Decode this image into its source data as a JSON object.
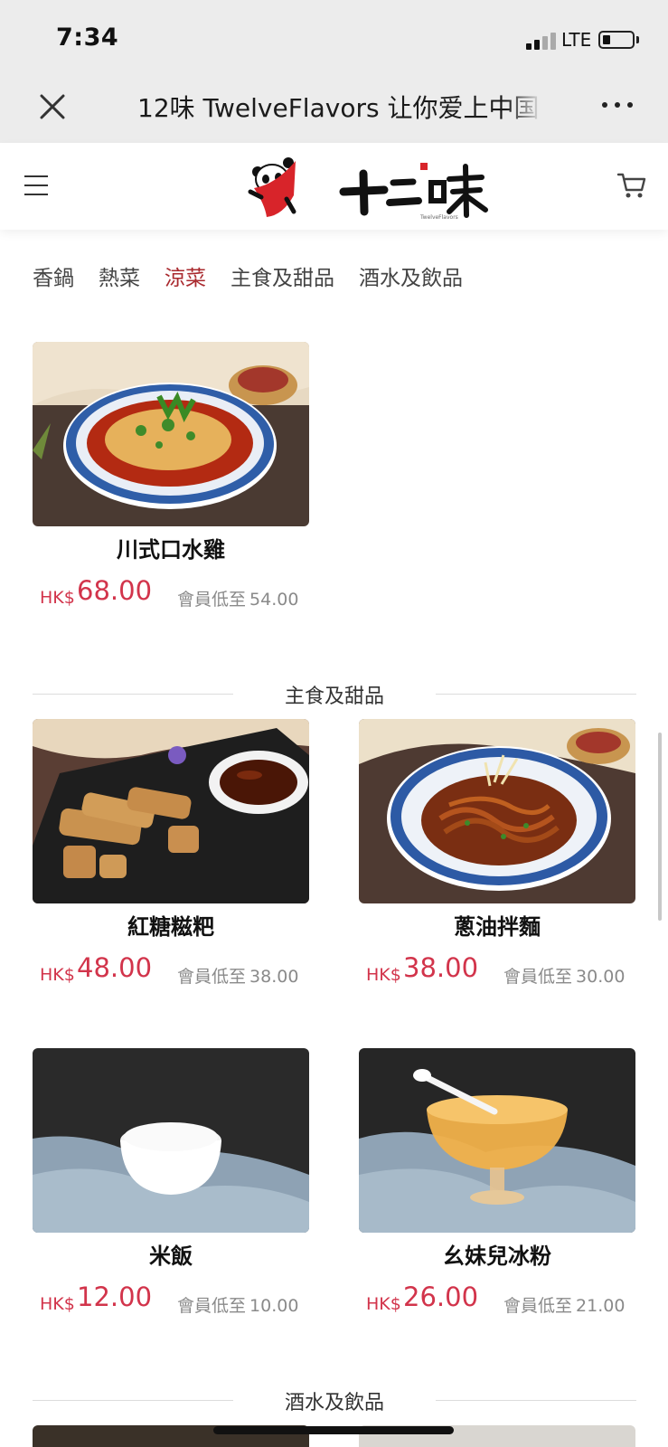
{
  "status_bar": {
    "time": "7:34",
    "network": "LTE"
  },
  "browser": {
    "title": "12味 TwelveFlavors 让你爱上中国",
    "close_icon": "close-icon",
    "more_icon": "more-dots-icon"
  },
  "header": {
    "menu_icon": "hamburger-menu-icon",
    "logo_text": "十二味",
    "cart_icon": "cart-icon"
  },
  "tabs": [
    {
      "label": "香鍋",
      "active": false
    },
    {
      "label": "熱菜",
      "active": false
    },
    {
      "label": "涼菜",
      "active": true
    },
    {
      "label": "主食及甜品",
      "active": false
    },
    {
      "label": "酒水及飲品",
      "active": false
    }
  ],
  "sections": {
    "staples": "主食及甜品",
    "drinks": "酒水及飲品"
  },
  "products": [
    {
      "name": "川式口水雞",
      "currency": "HK$",
      "price": "68.00",
      "member_label": "會員低至",
      "member_price": "54.00"
    },
    {
      "name": "紅糖糍粑",
      "currency": "HK$",
      "price": "48.00",
      "member_label": "會員低至",
      "member_price": "38.00"
    },
    {
      "name": "蔥油拌麵",
      "currency": "HK$",
      "price": "38.00",
      "member_label": "會員低至",
      "member_price": "30.00"
    },
    {
      "name": "米飯",
      "currency": "HK$",
      "price": "12.00",
      "member_label": "會員低至",
      "member_price": "10.00"
    },
    {
      "name": "幺妹兒冰粉",
      "currency": "HK$",
      "price": "26.00",
      "member_label": "會員低至",
      "member_price": "21.00"
    }
  ],
  "colors": {
    "accent": "#a9292e",
    "price": "#d2344b",
    "muted": "#8a8a8a"
  }
}
